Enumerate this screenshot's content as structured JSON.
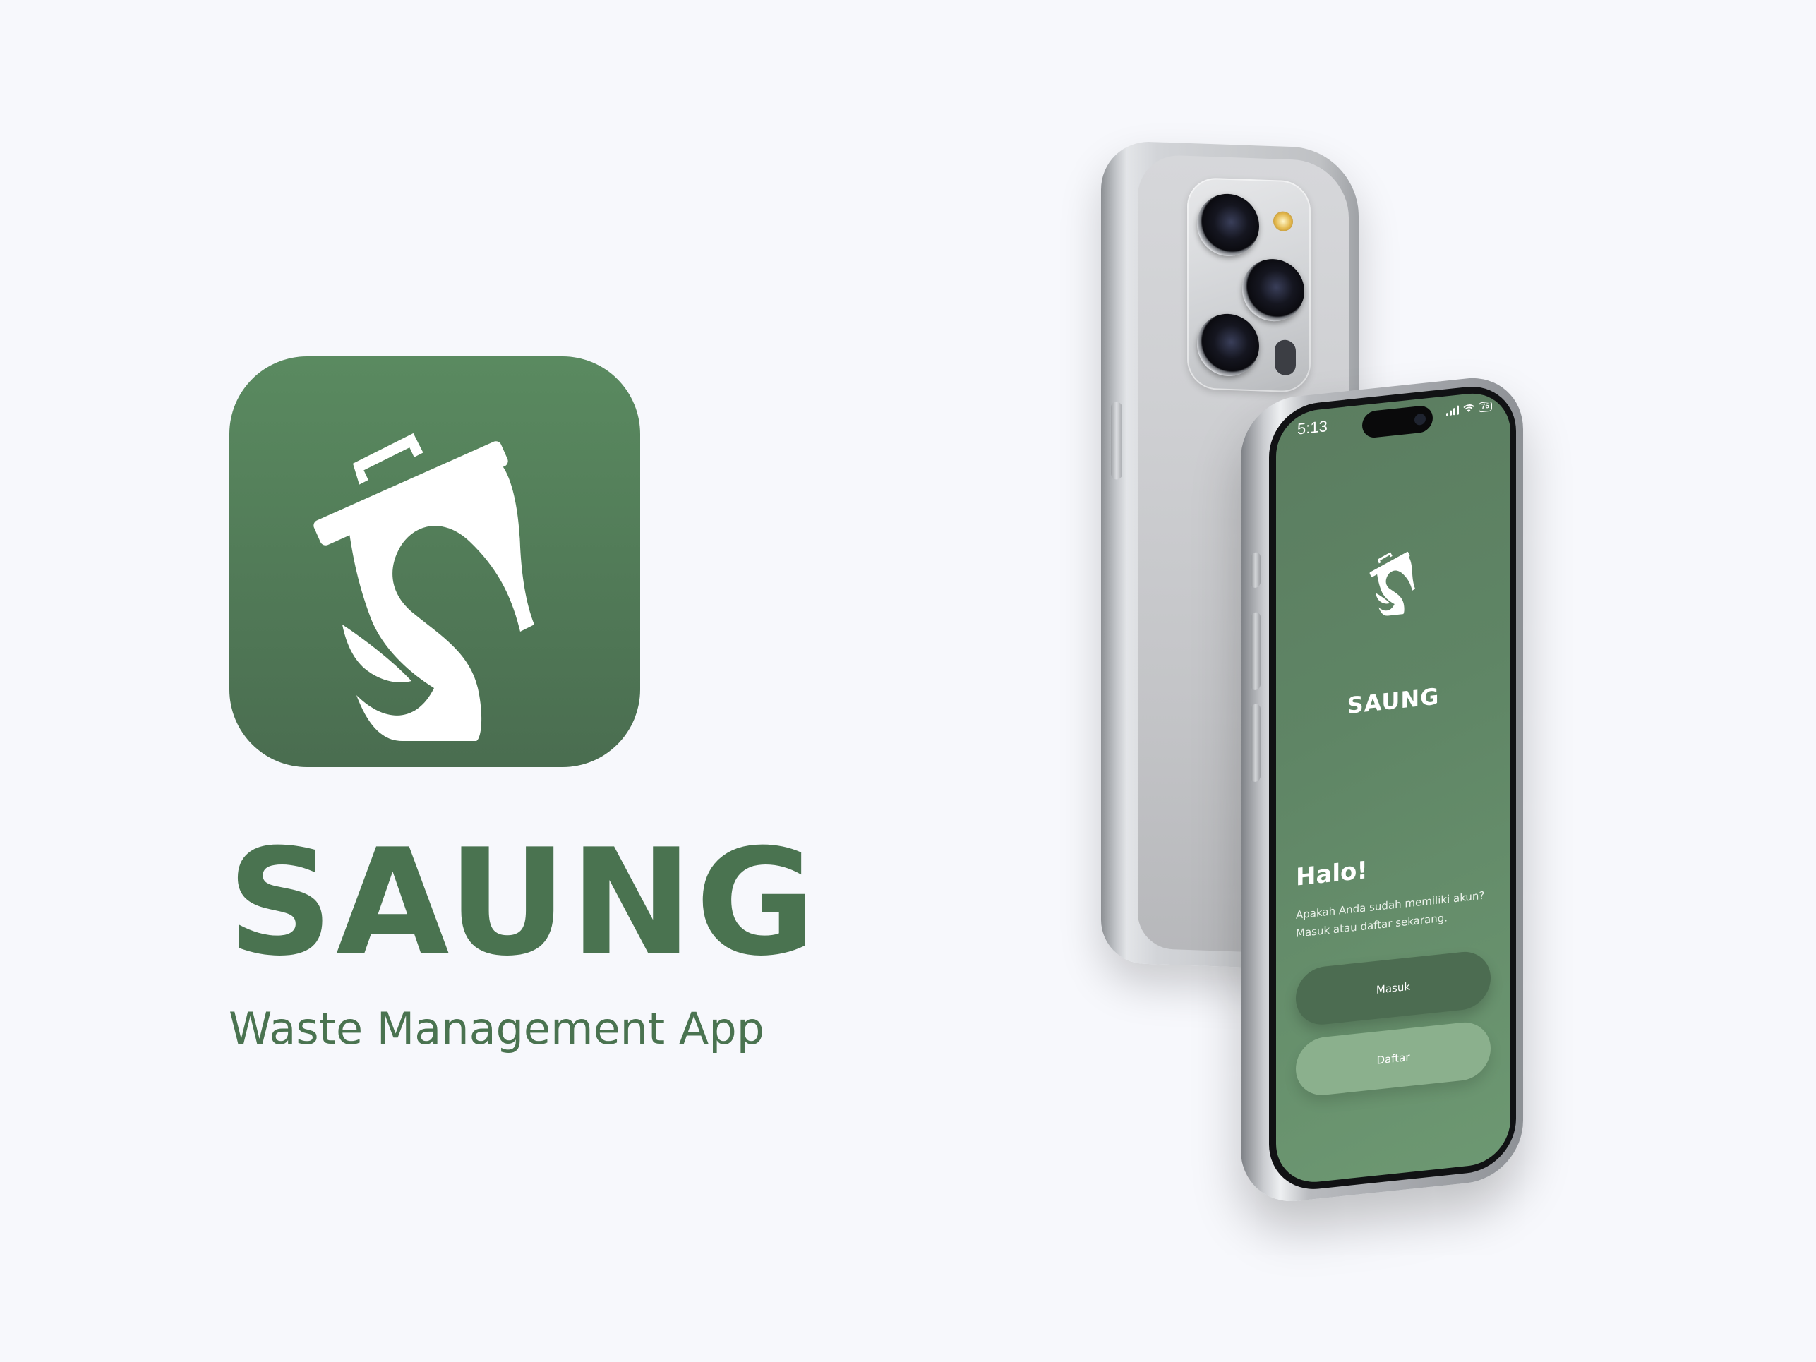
{
  "brand": {
    "name": "SAUNG",
    "tagline": "Waste Management App",
    "colors": {
      "primary": "#4a7350",
      "icon_top": "#5a8a60",
      "icon_bottom": "#4a6d50",
      "background": "#f7f8fc"
    },
    "icon": "trash-bin-s-logo-icon"
  },
  "phone": {
    "status_bar": {
      "time": "5:13",
      "battery": "76"
    },
    "screen": {
      "app_name": "SAUNG",
      "greeting": "Halo!",
      "subtext": "Apakah Anda sudah memiliki akun? Masuk atau daftar sekarang.",
      "buttons": {
        "login_label": "Masuk",
        "register_label": "Daftar"
      },
      "colors": {
        "screen_bg": "#5f8565",
        "login_button": "#4c6c51",
        "register_button": "#8bb08d"
      }
    }
  }
}
